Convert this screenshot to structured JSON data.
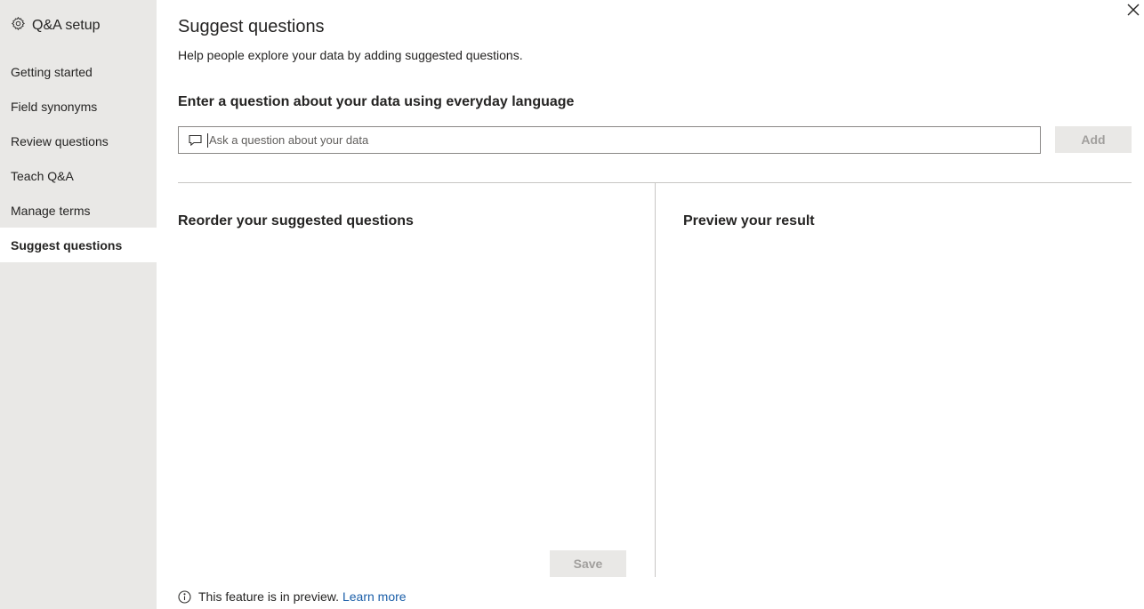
{
  "sidebar": {
    "header_icon": "gear-icon",
    "title": "Q&A setup",
    "items": [
      {
        "label": "Getting started",
        "active": false
      },
      {
        "label": "Field synonyms",
        "active": false
      },
      {
        "label": "Review questions",
        "active": false
      },
      {
        "label": "Teach Q&A",
        "active": false
      },
      {
        "label": "Manage terms",
        "active": false
      },
      {
        "label": "Suggest questions",
        "active": true
      }
    ]
  },
  "main": {
    "title": "Suggest questions",
    "subtitle": "Help people explore your data by adding suggested questions.",
    "question_label": "Enter a question about your data using everyday language",
    "question_input": {
      "icon": "chat-bubble-icon",
      "value": "",
      "placeholder": "Ask a question about your data"
    },
    "add_label": "Add",
    "reorder_title": "Reorder your suggested questions",
    "preview_title": "Preview your result",
    "save_label": "Save",
    "footer": {
      "icon": "info-icon",
      "text": "This feature is in preview.",
      "link": "Learn more"
    }
  },
  "colors": {
    "sidebar_bg": "#e9e8e6",
    "active_bg": "#ffffff",
    "link": "#1a5ea8",
    "disabled_button_bg": "#e9e8e6",
    "disabled_button_text": "#a19f9d",
    "divider": "#c8c6c4"
  }
}
